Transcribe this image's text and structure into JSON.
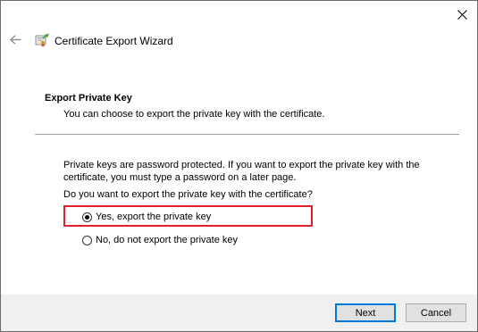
{
  "window": {
    "title": "Certificate Export Wizard"
  },
  "section": {
    "heading": "Export Private Key",
    "subheading": "You can choose to export the private key with the certificate."
  },
  "body": {
    "explanation": "Private keys are password protected. If you want to export the private key with the certificate, you must type a password on a later page.",
    "question": "Do you want to export the private key with the certificate?"
  },
  "options": [
    {
      "label": "Yes, export the private key",
      "selected": true
    },
    {
      "label": "No, do not export the private key",
      "selected": false
    }
  ],
  "buttons": {
    "next": "Next",
    "cancel": "Cancel"
  },
  "colors": {
    "highlight": "#e0202a",
    "default_button_border": "#0078d7",
    "footer_background": "#f0f0f0"
  },
  "icons": {
    "close": "close-icon",
    "back": "back-arrow-icon",
    "wizard": "certificate-wizard-icon"
  }
}
